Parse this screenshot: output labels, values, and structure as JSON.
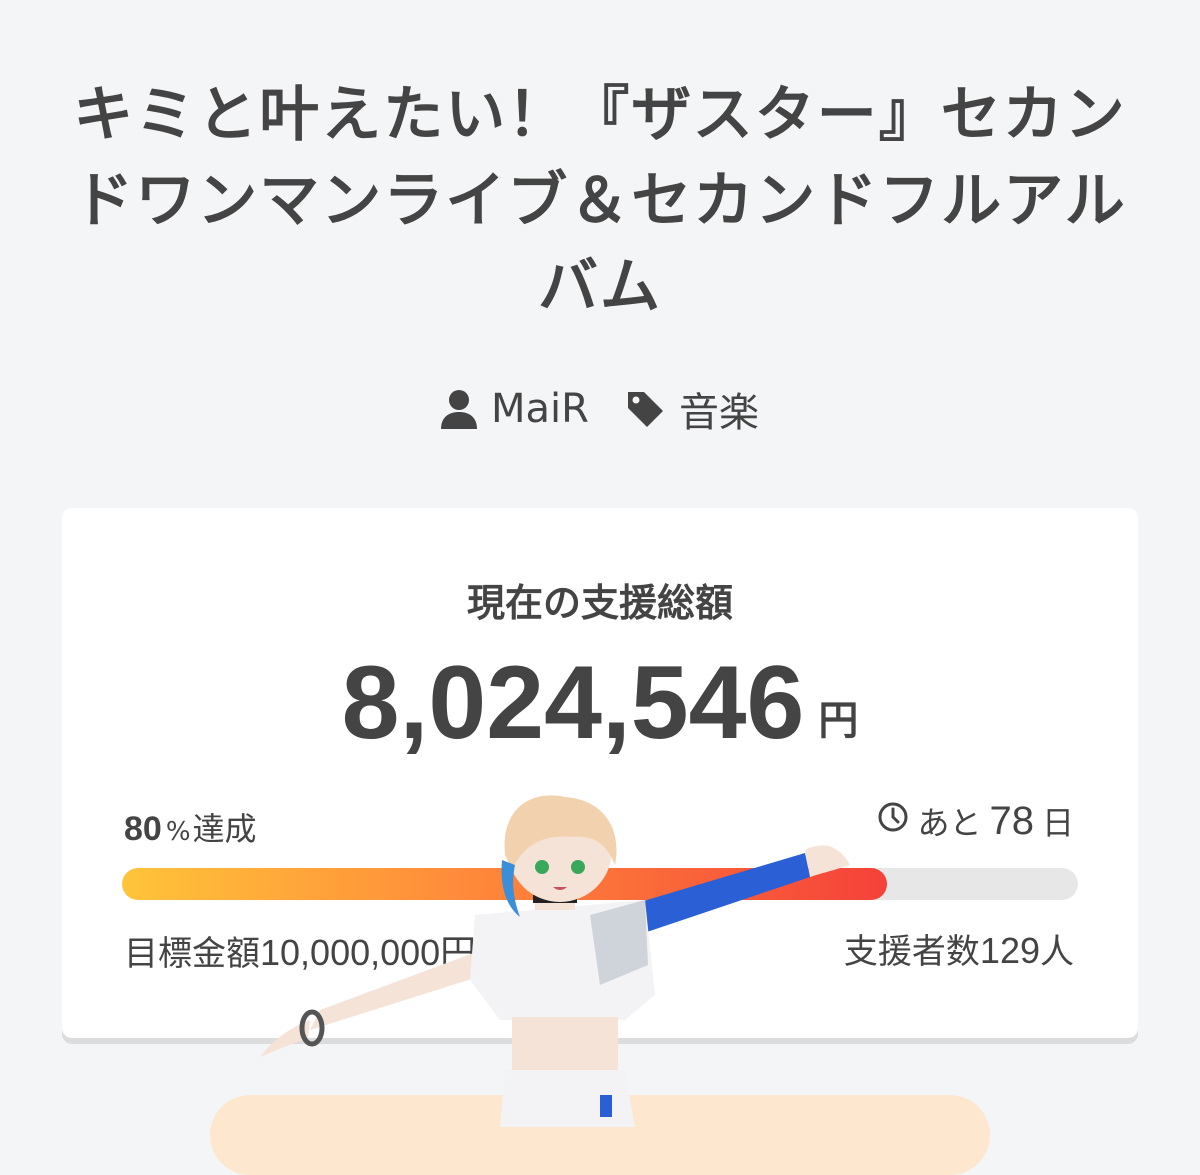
{
  "project": {
    "title": "キミと叶えたい！『ザスター』セカンドワンマンライブ＆セカンドフルアルバム",
    "author": "MaiR",
    "category": "音楽",
    "author_icon": "user-icon",
    "category_icon": "tag-icon"
  },
  "funding": {
    "label": "現在の支援総額",
    "amount": "8,024,546",
    "currency": "円",
    "percent_num": "80",
    "percent_sign": "%",
    "percent_label": "達成",
    "progress": 0.8,
    "remaining_prefix": "あと",
    "remaining_days": "78",
    "remaining_unit": "日",
    "target_label": "目標金額",
    "target_amount": "10,000,000円",
    "backers_label": "支援者数",
    "backers_count": "129",
    "backers_unit": "人"
  },
  "colors": {
    "bar_start": "#ffc43a",
    "bar_end": "#f5413a",
    "bar_track": "#e7e7e7",
    "text": "#444444"
  }
}
